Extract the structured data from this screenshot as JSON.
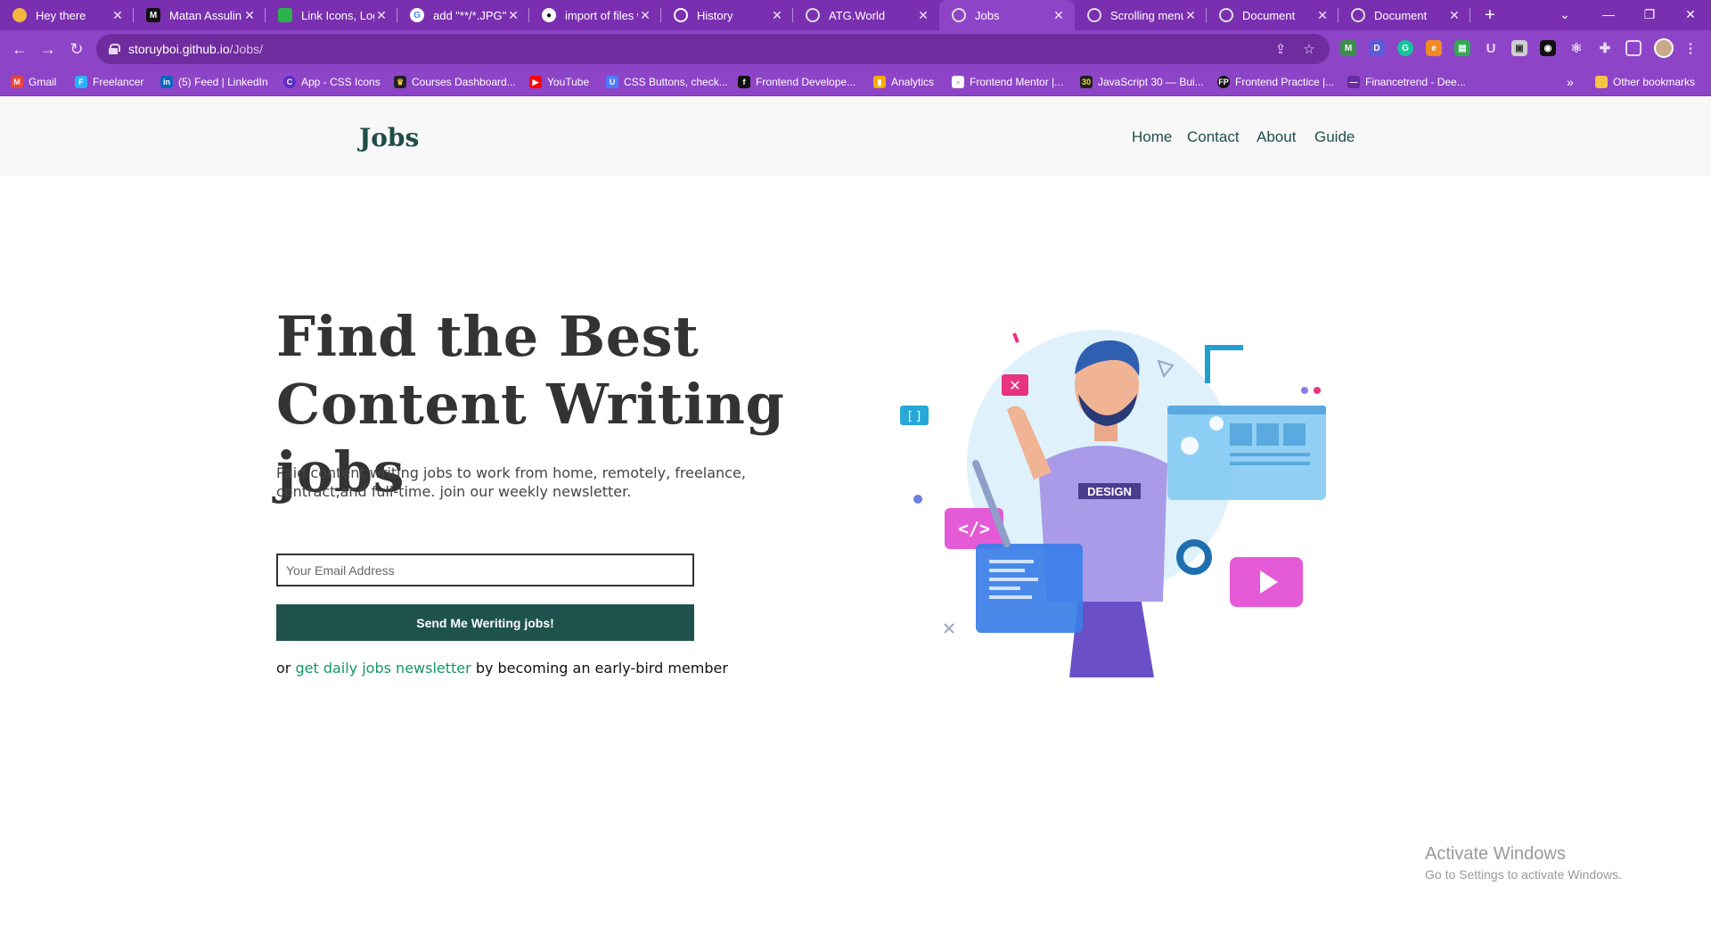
{
  "browser": {
    "tabs": [
      {
        "title": "Hey there",
        "favicon": "sun-icon",
        "color": "#f5b640"
      },
      {
        "title": "Matan Assulin |",
        "favicon": "m-logo-icon",
        "color": "#111111"
      },
      {
        "title": "Link Icons, Logo",
        "favicon": "green-square-icon",
        "color": "#2bb24c"
      },
      {
        "title": "add \"**/*.JPG\" t",
        "favicon": "google-icon",
        "color": "#ffffff"
      },
      {
        "title": "import of files w",
        "favicon": "github-icon",
        "color": "#ffffff"
      },
      {
        "title": "History",
        "favicon": "history-icon",
        "color": "#ffffff"
      },
      {
        "title": "ATG.World",
        "favicon": "globe-icon",
        "color": "#ffffff"
      },
      {
        "title": "Jobs",
        "favicon": "globe-icon",
        "color": "#ffffff"
      },
      {
        "title": "Scrolling menu",
        "favicon": "globe-icon",
        "color": "#ffffff"
      },
      {
        "title": "Document",
        "favicon": "globe-icon",
        "color": "#ffffff"
      },
      {
        "title": "Document",
        "favicon": "globe-icon",
        "color": "#ffffff"
      }
    ],
    "active_tab": "Jobs",
    "url_host": "storuyboi.github.io",
    "url_path": "/Jobs/",
    "bookmarks": [
      {
        "label": "Gmail",
        "icon": "gmail-icon",
        "color": "#ea4335"
      },
      {
        "label": "Freelancer",
        "icon": "freelancer-icon",
        "color": "#29b2fe"
      },
      {
        "label": "(5) Feed | LinkedIn",
        "icon": "linkedin-icon",
        "color": "#0a66c2"
      },
      {
        "label": "App - CSS Icons",
        "icon": "css-icons-icon",
        "color": "#5b2cc9"
      },
      {
        "label": "Courses Dashboard...",
        "icon": "crown-icon",
        "color": "#222222"
      },
      {
        "label": "YouTube",
        "icon": "youtube-icon",
        "color": "#ff0000"
      },
      {
        "label": "CSS Buttons, check...",
        "icon": "css-buttons-icon",
        "color": "#4a7bff"
      },
      {
        "label": "Frontend Develope...",
        "icon": "frontend-dev-icon",
        "color": "#111111"
      },
      {
        "label": "Analytics",
        "icon": "analytics-icon",
        "color": "#f9ab00"
      },
      {
        "label": "Frontend Mentor |...",
        "icon": "frontend-mentor-icon",
        "color": "#ffffff"
      },
      {
        "label": "JavaScript 30 — Bui...",
        "icon": "js30-icon",
        "color": "#222222"
      },
      {
        "label": "Frontend Practice |...",
        "icon": "fp-icon",
        "color": "#111111"
      },
      {
        "label": "Financetrend - Dee...",
        "icon": "financetrend-icon",
        "color": "#7a2fb0"
      }
    ],
    "other_bookmarks": "Other bookmarks",
    "more_bookmarks": "»"
  },
  "site": {
    "logo": "Jobs",
    "nav": [
      "Home",
      "Contact",
      "About",
      "Guide"
    ]
  },
  "hero": {
    "title": "Find the Best Content Writing jobs",
    "subtitle": "Paid content writing jobs to work from home, remotely, freelance, contract,and full-time. join our weekly newsletter.",
    "email_placeholder": "Your Email Address",
    "button_label": "Send Me Weriting jobs!",
    "or_prefix": "or",
    "or_link": "get daily jobs newsletter",
    "or_suffix": "by becoming an early-bird member",
    "illustration_badge": "DESIGN"
  },
  "watermark": {
    "line1": "Activate Windows",
    "line2": "Go to Settings to activate Windows."
  },
  "colors": {
    "chrome": "#8e44c7",
    "brand": "#1f4e4a",
    "button": "#1f524d",
    "link": "#17956c"
  }
}
